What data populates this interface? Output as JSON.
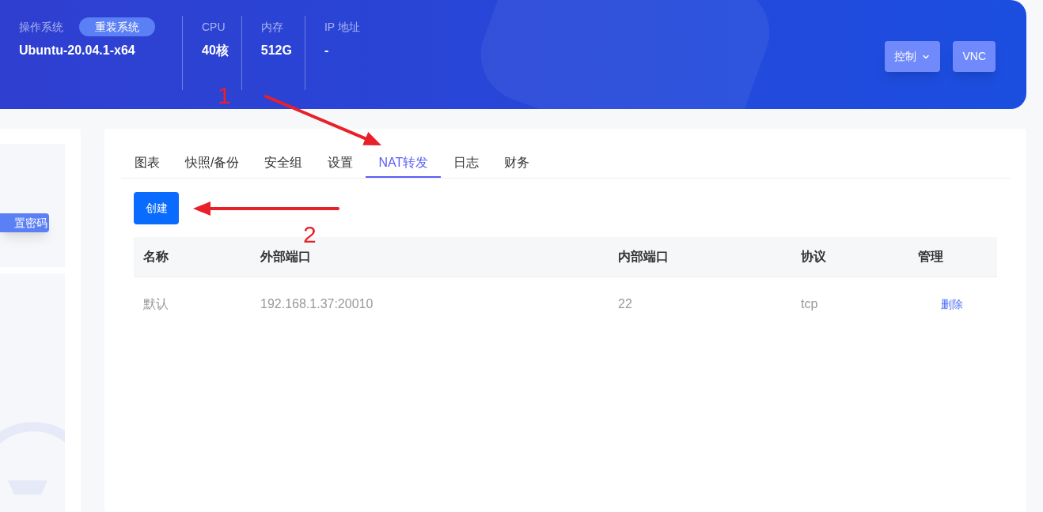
{
  "header": {
    "os": {
      "label": "操作系统",
      "value": "Ubuntu-20.04.1-x64",
      "reinstall_button": "重装系统"
    },
    "stats": [
      {
        "label": "CPU",
        "value": "40核"
      },
      {
        "label": "内存",
        "value": "512G"
      },
      {
        "label": "IP 地址",
        "value": "-"
      }
    ],
    "buttons": [
      {
        "label": "控制",
        "dropdown": true
      },
      {
        "label": "VNC",
        "dropdown": false
      }
    ]
  },
  "left_panel": {
    "button": "置密码"
  },
  "tabs": [
    {
      "label": "图表",
      "selected": false
    },
    {
      "label": "快照/备份",
      "selected": false
    },
    {
      "label": "安全组",
      "selected": false
    },
    {
      "label": "设置",
      "selected": false
    },
    {
      "label": "NAT转发",
      "selected": true
    },
    {
      "label": "日志",
      "selected": false
    },
    {
      "label": "财务",
      "selected": false
    }
  ],
  "create_button": "创建",
  "table": {
    "columns": [
      "名称",
      "外部端口",
      "内部端口",
      "协议",
      "管理"
    ],
    "rows": [
      {
        "cells": [
          "默认",
          "192.168.1.37:20010",
          "22",
          "tcp"
        ],
        "action": "删除"
      }
    ]
  },
  "annotations": [
    {
      "label": "1"
    },
    {
      "label": "2"
    }
  ]
}
